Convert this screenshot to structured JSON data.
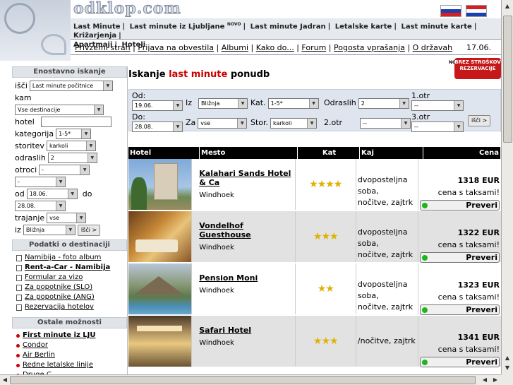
{
  "header": {
    "brand": "odklop.com",
    "top_nav": [
      {
        "label": "Last Minute"
      },
      {
        "label": "Last minute iz Ljubljane",
        "badge": "NOVO"
      },
      {
        "label": "Last minute Jadran"
      },
      {
        "label": "Letalske karte"
      },
      {
        "label": "Last minute karte"
      },
      {
        "label": "Križarjenja"
      },
      {
        "label": "Apartmaji"
      },
      {
        "label": "Hoteli"
      }
    ],
    "sub_nav": [
      "Privzemi stran",
      "Prijava na obvestila",
      "Albumi",
      "Kako do...",
      "Forum",
      "Pogosta vprašanja",
      "O državah"
    ],
    "date": "17.06.",
    "flags": [
      "slovenia-flag",
      "croatia-flag"
    ]
  },
  "sidebar": {
    "search_title": "Enostavno iskanje",
    "labels": {
      "isci": "išči",
      "kam": "kam",
      "hotel": "hotel",
      "kategorija": "kategorija",
      "storitev": "storitev",
      "odraslih": "odraslih",
      "otroci": "otroci",
      "od": "od",
      "do": "do",
      "trajanje": "trajanje",
      "iz": "iz"
    },
    "values": {
      "isci": "Last minute počitnice",
      "kam": "Vse destinacije",
      "kategorija": "1-5*",
      "storitev": "karkoli",
      "odraslih": "2",
      "otroci": "-",
      "otroci2": "-",
      "od": "18.06.",
      "do": "28.08.",
      "trajanje": "vse",
      "iz": "Bližnja"
    },
    "search_button": "Išči >",
    "dest_title": "Podatki o destinaciji",
    "dest_links": [
      "Namibija - foto album",
      "Rent-a-Car - Namibija",
      "Formular za vizo",
      "Za popotnike (SLO)",
      "Za popotnike (ANG)",
      "Rezervacija hotelov"
    ],
    "other_title": "Ostale možnosti",
    "other_links": [
      "First minute iz LJU",
      "Condor",
      "Air Berlin",
      "Redne letalske linije",
      "Druge C..."
    ]
  },
  "main": {
    "title_pre": "Iskanje",
    "title_red": "last minute",
    "title_post": "ponudb",
    "badge_new": "NOVO",
    "badge_text": "BREZ STROŠKOV REZERVACIJE",
    "form": {
      "od_label": "Od:",
      "od_value": "19.06.",
      "do_label": "Do:",
      "do_value": "28.08.",
      "iz_label": "Iz",
      "iz_value": "Bližnja",
      "za_label": "Za",
      "za_value": "vse",
      "kat_label": "Kat.",
      "kat_value": "1-5*",
      "stor_label": "Stor.",
      "stor_value": "karkoli",
      "odr_label": "Odraslih",
      "odr_value": "2",
      "otr2_label": "2.otr",
      "otr2_value": "--",
      "otr1_label": "1.otr",
      "otr1_value": "--",
      "otr3_label": "3.otr",
      "otr3_value": "--",
      "button": "išči >"
    },
    "columns": [
      "Hotel",
      "Mesto",
      "Kat",
      "Kaj",
      "Cena"
    ],
    "rows": [
      {
        "name": "Kalahari Sands Hotel & Ca",
        "city": "Windhoek",
        "stars": 4,
        "stars_text": "★★★★",
        "kaj": [
          "dvoposteljna",
          "soba,",
          "nočitve, zajtrk"
        ],
        "price": "1318 EUR",
        "tax": "cena s taksami!",
        "button": "Preveri"
      },
      {
        "name": "Vondelhof Guesthouse",
        "city": "Windhoek",
        "stars": 3,
        "stars_text": "★★★",
        "kaj": [
          "dvoposteljna",
          "soba,",
          "nočitve, zajtrk"
        ],
        "price": "1322 EUR",
        "tax": "cena s taksami!",
        "button": "Preveri"
      },
      {
        "name": "Pension Moni",
        "city": "Windhoek",
        "stars": 2,
        "stars_text": "★★",
        "kaj": [
          "dvoposteljna",
          "soba,",
          "nočitve, zajtrk"
        ],
        "price": "1323 EUR",
        "tax": "cena s taksami!",
        "button": "Preveri"
      },
      {
        "name": "Safari Hotel",
        "city": "Windhoek",
        "stars": 3,
        "stars_text": "★★★",
        "kaj": [
          "/nočitve, zajtrk"
        ],
        "price": "1341 EUR",
        "tax": "cena s taksami!",
        "button": "Preveri"
      }
    ]
  },
  "colors": {
    "accent_red": "#cc0000",
    "nav_bg": "#e6e9ee",
    "form_bg": "#dfe5ef",
    "star": "#e0b000",
    "go_dot": "#1bb81b"
  }
}
